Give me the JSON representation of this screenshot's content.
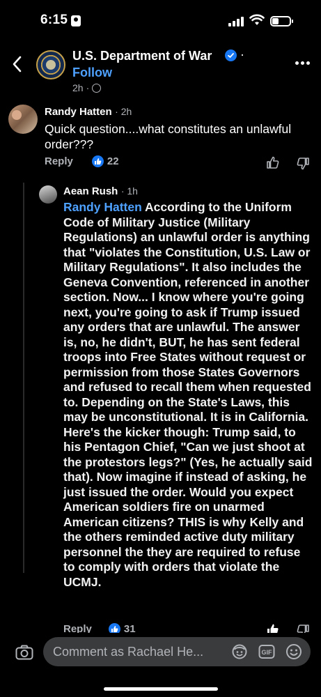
{
  "status_bar": {
    "time": "6:15"
  },
  "header": {
    "page_name": "U.S. Department of War",
    "follow_label": "Follow",
    "post_age": "2h",
    "separator": "·"
  },
  "comments": [
    {
      "author": "Randy Hatten",
      "age": "· 2h",
      "text": "Quick question....what constitutes an unlawful order???",
      "reply_label": "Reply",
      "like_count": "22"
    },
    {
      "author": "Aean Rush",
      "age": "· 1h",
      "mention": "Randy Hatten",
      "text": " According to the Uniform Code of Military Justice (Military Regulations) an unlawful order is anything that \"violates the Constitution, U.S. Law or Military Regulations\". It also includes the Geneva Convention, referenced in another section. Now... I know where you're going next, you're going to ask if Trump issued any orders that are unlawful. The answer is, no, he didn't, BUT, he has sent federal troops into Free States without request or permission from those States Governors and refused to recall them when requested to. Depending on the State's Laws, this may be unconstitutional. It is in California. Here's the kicker though: Trump said, to his Pentagon Chief, \"Can we just shoot at the protestors legs?\" (Yes, he actually said that). Now imagine if instead of asking, he just issued the order. Would you expect American soldiers fire on unarmed American citizens? THIS is why Kelly and the others reminded active duty military personnel the they are required to refuse to comply with orders that violate the UCMJ.",
      "reply_label": "Reply",
      "like_count": "31"
    }
  ],
  "composer": {
    "placeholder": "Comment as Rachael He..."
  },
  "colors": {
    "accent": "#1877f2",
    "link": "#4ea1ff",
    "muted": "#b0b3b8",
    "input_bg": "#3a3b3c"
  }
}
